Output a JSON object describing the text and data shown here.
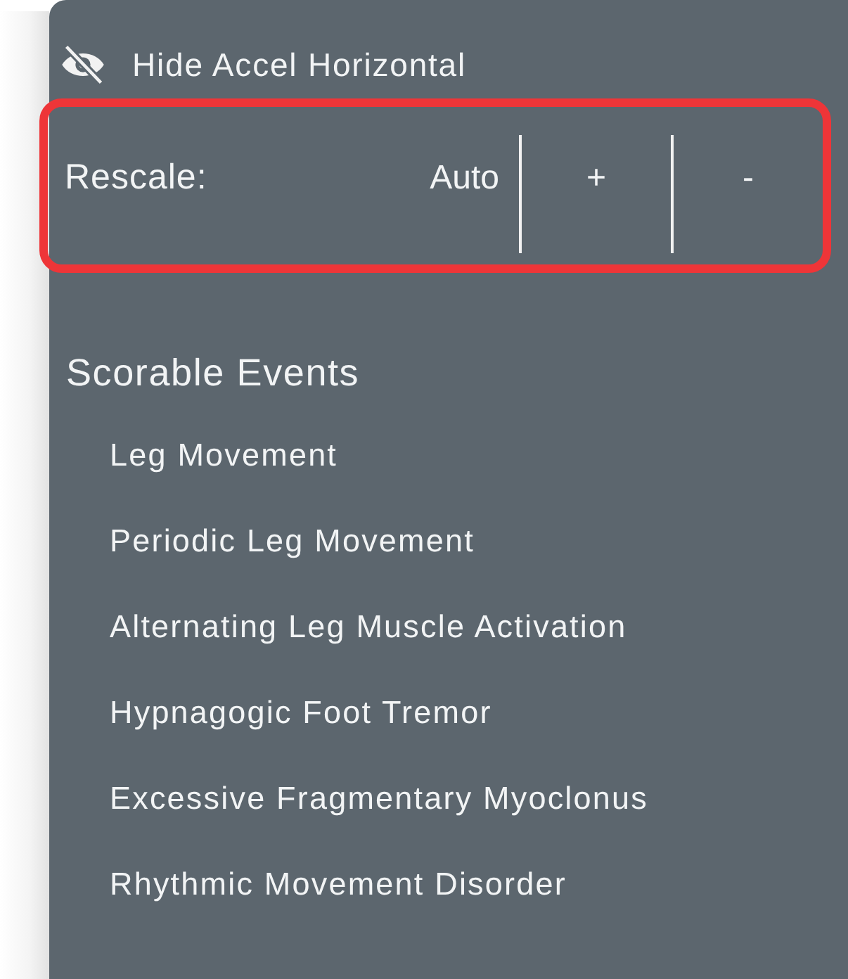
{
  "toggle": {
    "label": "Hide Accel Horizontal",
    "hidden": true
  },
  "rescale": {
    "label": "Rescale:",
    "highlighted": true,
    "buttons": [
      "Auto",
      "+",
      "-"
    ]
  },
  "scorable_events": {
    "title": "Scorable Events",
    "items": [
      "Leg Movement",
      "Periodic Leg Movement",
      "Alternating Leg Muscle Activation",
      "Hypnagogic Foot Tremor",
      "Excessive Fragmentary Myoclonus",
      "Rhythmic Movement Disorder"
    ]
  }
}
